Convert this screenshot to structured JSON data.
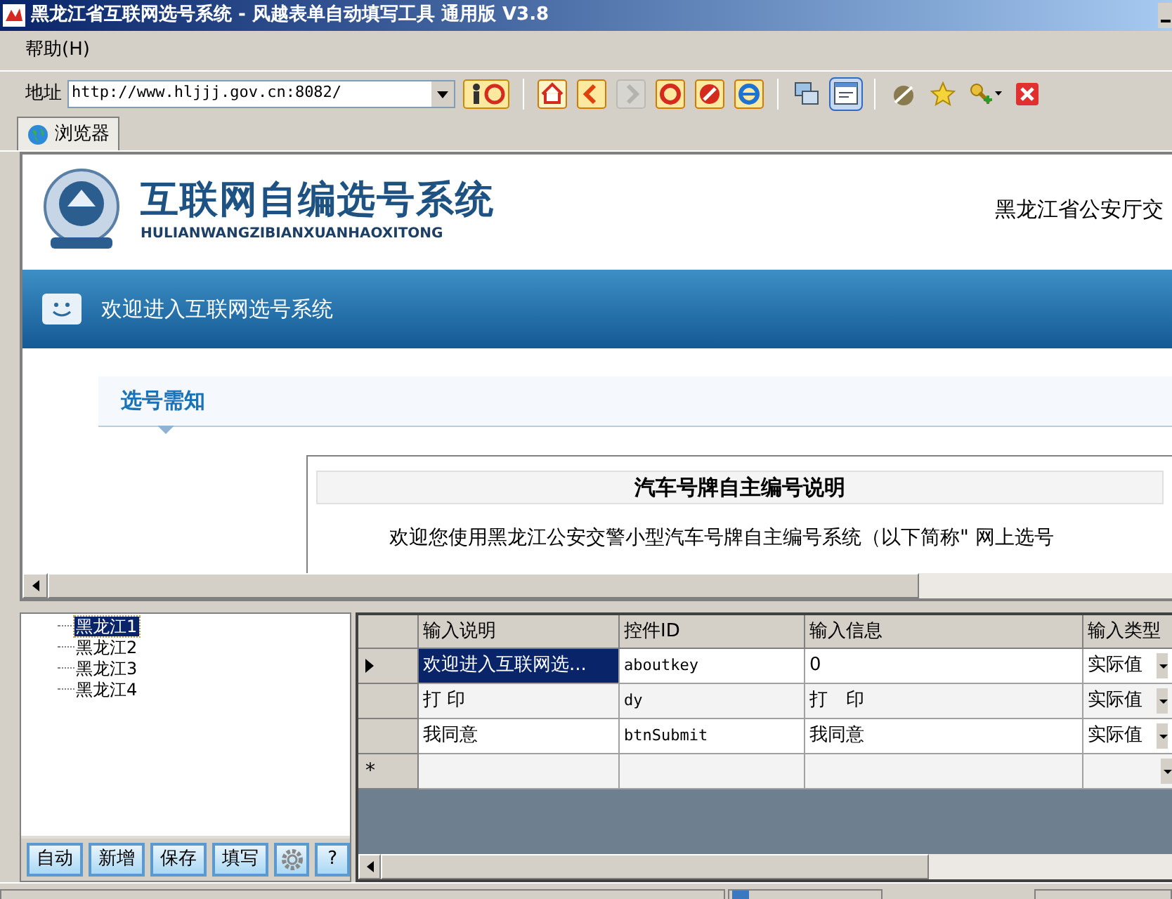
{
  "window": {
    "title": "黑龙江省互联网选号系统 - 风越表单自动填写工具 通用版 V3.8"
  },
  "menu": [
    {
      "label": "帮助(H)"
    }
  ],
  "toolbar": {
    "address_label": "地址",
    "address": "http://www.hljjj.gov.cn:8082/",
    "buttons": [
      {
        "disabled": false,
        "pressed": false
      },
      {
        "disabled": false,
        "pressed": false
      },
      {
        "disabled": false,
        "pressed": false
      },
      {
        "disabled": true,
        "pressed": false
      },
      {
        "disabled": false,
        "pressed": false
      },
      {
        "disabled": false,
        "pressed": false
      },
      {
        "disabled": false,
        "pressed": false
      },
      {
        "disabled": false,
        "pressed": false
      },
      {
        "disabled": false,
        "pressed": true
      },
      {
        "disabled": false,
        "pressed": false
      },
      {
        "disabled": false,
        "pressed": false
      },
      {
        "disabled": false,
        "pressed": false
      },
      {
        "disabled": false,
        "pressed": false
      }
    ]
  },
  "tabs": [
    {
      "label": "浏览器",
      "selected": true
    }
  ],
  "web_page": {
    "site_title": "互联网自编选号系统",
    "site_subtitle": "HULIANWANGZIBIANXUANHAOXITONG",
    "department": "黑龙江省公安厅交",
    "banner": "欢迎进入互联网选号系统",
    "section_tab": "选号需知",
    "notice_title": "汽车号牌自主编号说明",
    "notice_text": "欢迎您使用黑龙江公安交警小型汽车号牌自主编号系统（以下简称\" 网上选号"
  },
  "tree": [
    {
      "label": "黑龙江1",
      "selected": true
    },
    {
      "label": "黑龙江2",
      "selected": false
    },
    {
      "label": "黑龙江3",
      "selected": false
    },
    {
      "label": "黑龙江4",
      "selected": false
    }
  ],
  "actions": [
    {
      "kind": "text",
      "label": "自动"
    },
    {
      "kind": "text",
      "label": "新增"
    },
    {
      "kind": "text",
      "label": "保存"
    },
    {
      "kind": "text",
      "label": "填写"
    },
    {
      "kind": "settings"
    },
    {
      "kind": "text",
      "label": "?"
    }
  ],
  "table": {
    "columns": [
      "输入说明",
      "控件ID",
      "输入信息",
      "输入类型"
    ],
    "rows": [
      {
        "cells": [
          "欢迎进入互联网选...",
          "aboutkey",
          "0",
          "实际值"
        ],
        "current": true
      },
      {
        "cells": [
          "打 印",
          "dy",
          "打　印",
          "实际值"
        ],
        "current": false
      },
      {
        "cells": [
          "我同意",
          "btnSubmit",
          "我同意",
          "实际值"
        ],
        "current": false
      }
    ],
    "new_row_marker": "*"
  }
}
